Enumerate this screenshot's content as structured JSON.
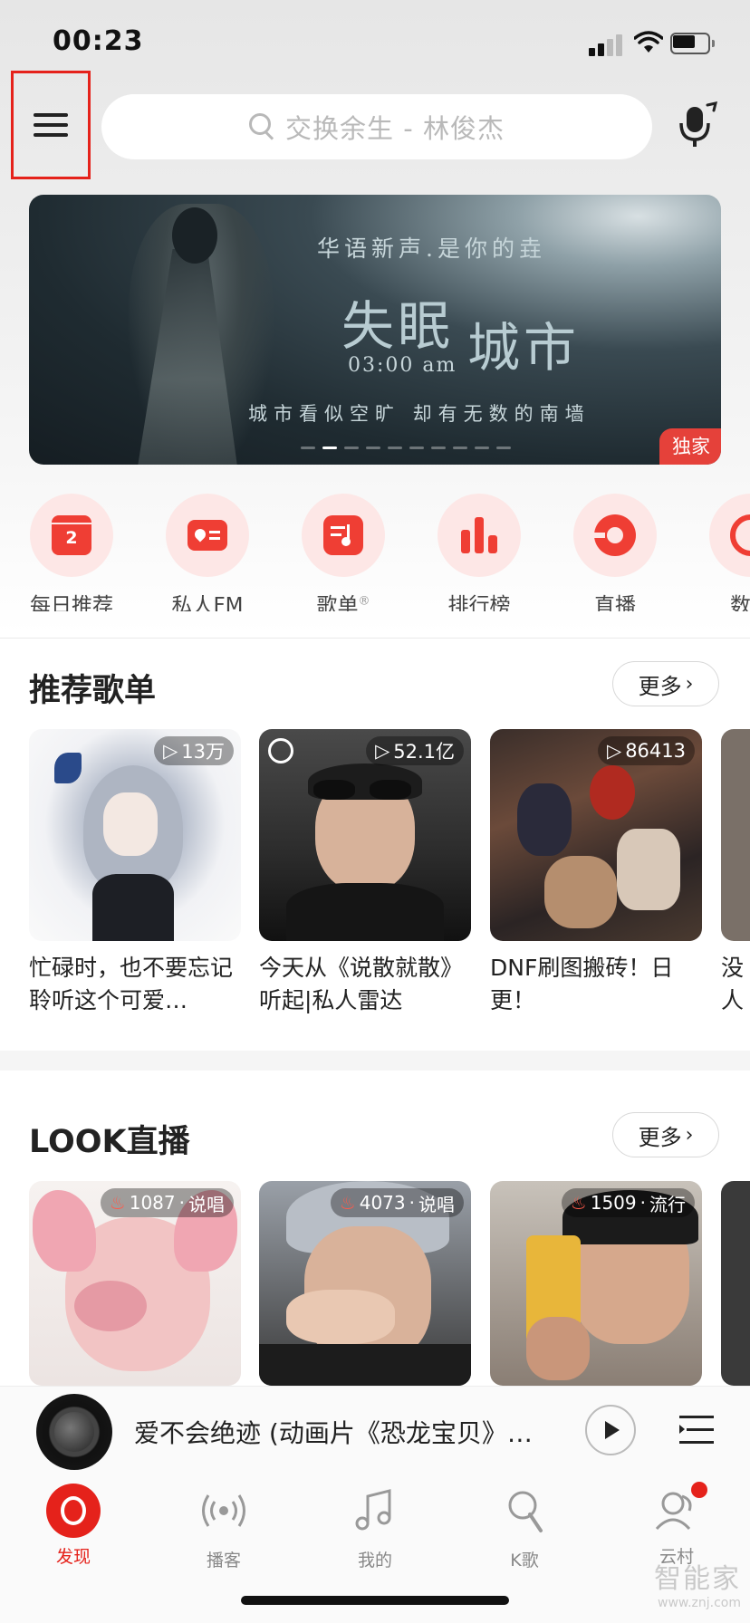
{
  "status_bar": {
    "time": "00:23"
  },
  "header": {
    "search_placeholder": "交换余生 - 林俊杰"
  },
  "banner": {
    "subtitle": "华语新声.是你的垚",
    "title_part1": "失眠",
    "title_part2": "城市",
    "time_text": "03:00  am",
    "caption": "城市看似空旷 却有无数的南墙",
    "tag": "独家",
    "page_count": 10,
    "active_page": 2
  },
  "quick_entries": [
    {
      "label": "每日推荐",
      "icon": "calendar-icon",
      "badge": "2"
    },
    {
      "label": "私人FM",
      "icon": "radio-icon"
    },
    {
      "label": "歌单",
      "icon": "playlist-icon",
      "suffix": "®"
    },
    {
      "label": "排行榜",
      "icon": "chart-bars-icon"
    },
    {
      "label": "直播",
      "icon": "live-disc-icon"
    },
    {
      "label": "数字",
      "icon": "digital-album-icon"
    }
  ],
  "recommend": {
    "title": "推荐歌单",
    "more": "更多",
    "cards": [
      {
        "title": "忙碌时，也不要忘记聆听这个可爱…",
        "play_count": "13万"
      },
      {
        "title": "今天从《说散就散》听起|私人雷达",
        "play_count": "52.1亿"
      },
      {
        "title": "DNF刷图搬砖！日更！",
        "play_count": "86413"
      },
      {
        "title": "没人和乐",
        "play_count": ""
      }
    ]
  },
  "look_live": {
    "title": "LOOK直播",
    "more": "更多",
    "cards": [
      {
        "viewers": "1087",
        "genre": "说唱"
      },
      {
        "viewers": "4073",
        "genre": "说唱"
      },
      {
        "viewers": "1509",
        "genre": "流行"
      }
    ]
  },
  "player": {
    "song": "爱不会绝迹 (动画片《恐龙宝贝》…"
  },
  "bottom_nav": [
    {
      "label": "发现",
      "active": true
    },
    {
      "label": "播客"
    },
    {
      "label": "我的"
    },
    {
      "label": "K歌"
    },
    {
      "label": "云村",
      "has_badge": true
    }
  ],
  "colors": {
    "accent": "#e5221b",
    "tint": "#fde7e6"
  },
  "watermark": {
    "line1": "智能家",
    "line2": "www.znj.com"
  }
}
